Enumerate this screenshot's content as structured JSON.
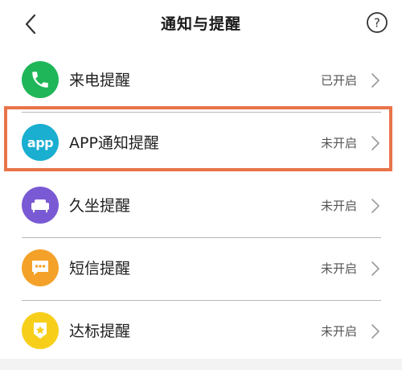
{
  "header": {
    "title": "通知与提醒",
    "back_icon": "chevron-left-icon",
    "help_icon": "question-circle-icon",
    "help_glyph": "?"
  },
  "rows": [
    {
      "label": "来电提醒",
      "status": "已开启",
      "icon": "phone-icon",
      "color": "#1fb65a"
    },
    {
      "label": "APP通知提醒",
      "status": "未开启",
      "icon": "app-icon",
      "icon_text": "app",
      "color": "#1aaed0",
      "highlighted": true
    },
    {
      "label": "久坐提醒",
      "status": "未开启",
      "icon": "sofa-icon",
      "color": "#7a5ad4"
    },
    {
      "label": "短信提醒",
      "status": "未开启",
      "icon": "message-icon",
      "color": "#f4a12a"
    },
    {
      "label": "达标提醒",
      "status": "未开启",
      "icon": "badge-star-icon",
      "color": "#f7cf1b"
    }
  ],
  "highlight_color": "#e8744a"
}
